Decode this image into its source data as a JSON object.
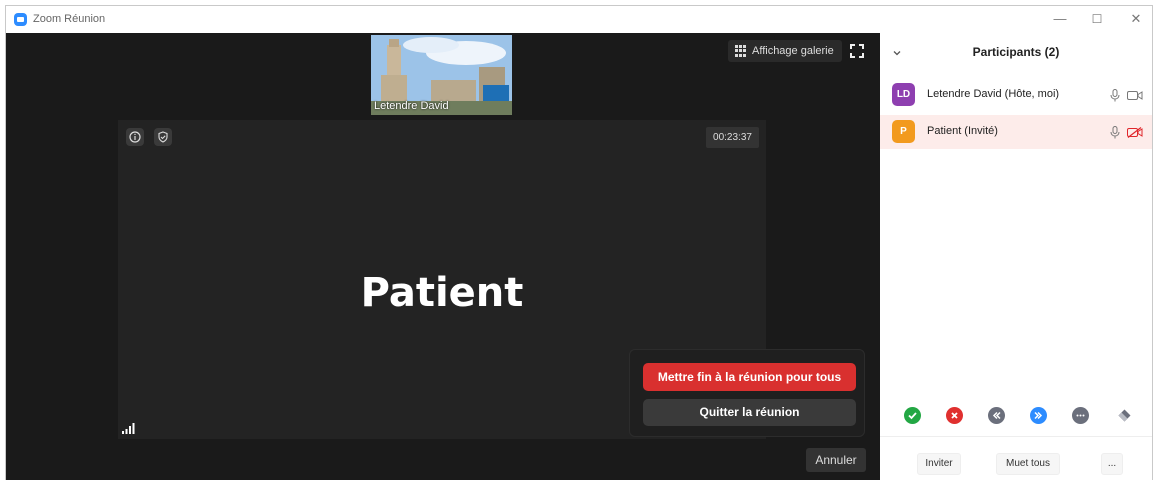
{
  "window": {
    "title": "Zoom Réunion"
  },
  "window_controls": {
    "minimize": "—",
    "maximize": "☐",
    "close": "✕"
  },
  "stage": {
    "thumbnail_label": "Letendre David",
    "gallery_label": "Affichage galerie",
    "timer": "00:23:37",
    "main_name": "Patient"
  },
  "end_popup": {
    "end_all_label": "Mettre fin à la réunion pour tous",
    "leave_label": "Quitter la réunion"
  },
  "cancel_label": "Annuler",
  "participants": {
    "title": "Participants (2)",
    "items": [
      {
        "initials": "LD",
        "name": "Letendre David (Hôte, moi)",
        "avatar_color": "#8e3fb0",
        "video": "on"
      },
      {
        "initials": "P",
        "name": "Patient (Invité)",
        "avatar_color": "#f29a1e",
        "video": "off"
      }
    ]
  },
  "reactions": [
    "yes-icon",
    "no-icon",
    "slower-icon",
    "faster-icon",
    "more-icon",
    "clear-icon"
  ],
  "footer": {
    "invite": "Inviter",
    "mute_all": "Muet tous",
    "more": "..."
  },
  "colors": {
    "end_red": "#d9302f",
    "zoom_blue": "#2d8cff",
    "highlight_row": "#fdecea"
  }
}
